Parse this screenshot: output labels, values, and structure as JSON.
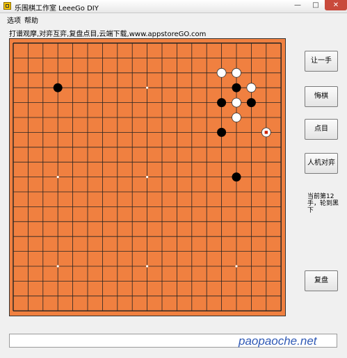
{
  "window": {
    "title": "乐围棋工作室 LeeeGo DIY",
    "app_icon": "go-board-icon",
    "controls": {
      "minimize": "—",
      "maximize": "□",
      "close": "✕"
    }
  },
  "menu": {
    "options": "选项",
    "help": "帮助"
  },
  "info_text": "打谱观摩,对弈互弈,复盘点目,云端下载,www.appstoreGO.com",
  "board": {
    "size": 19,
    "colors": {
      "wood": "#f08040",
      "line": "#222222"
    },
    "star_points": [
      [
        3,
        3
      ],
      [
        9,
        3
      ],
      [
        15,
        3
      ],
      [
        3,
        9
      ],
      [
        9,
        9
      ],
      [
        15,
        9
      ],
      [
        3,
        15
      ],
      [
        9,
        15
      ],
      [
        15,
        15
      ]
    ],
    "stones": [
      {
        "color": "white",
        "col": 14,
        "row": 2
      },
      {
        "color": "white",
        "col": 15,
        "row": 2
      },
      {
        "color": "black",
        "col": 3,
        "row": 3
      },
      {
        "color": "black",
        "col": 15,
        "row": 3
      },
      {
        "color": "white",
        "col": 16,
        "row": 3
      },
      {
        "color": "black",
        "col": 14,
        "row": 4
      },
      {
        "color": "white",
        "col": 15,
        "row": 4
      },
      {
        "color": "black",
        "col": 16,
        "row": 4
      },
      {
        "color": "white",
        "col": 15,
        "row": 5
      },
      {
        "color": "black",
        "col": 14,
        "row": 6
      },
      {
        "color": "white",
        "col": 17,
        "row": 6,
        "last_move": true
      },
      {
        "color": "black",
        "col": 15,
        "row": 9
      }
    ]
  },
  "buttons": {
    "handicap": "让一手",
    "undo": "悔棋",
    "count": "点目",
    "vs_computer": "人机对弈",
    "replay": "复盘"
  },
  "status": "当前第12手，轮到黑下",
  "bottom_input": {
    "value": ""
  },
  "watermark": "paopaoche.net"
}
